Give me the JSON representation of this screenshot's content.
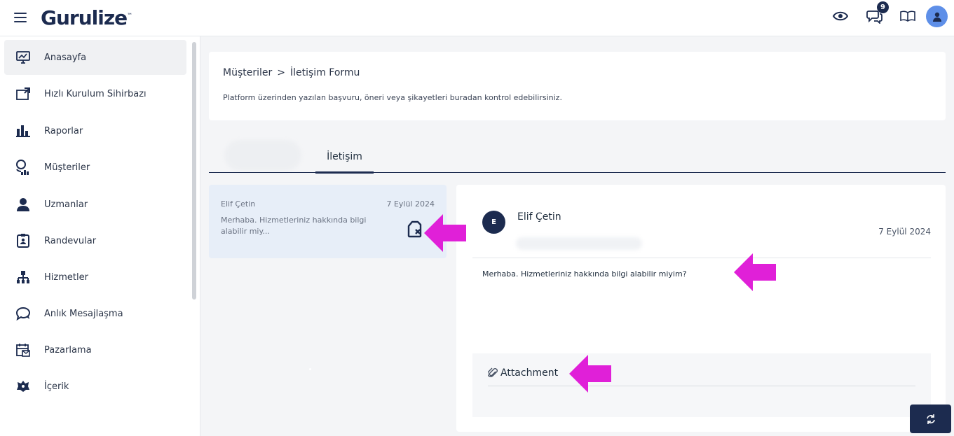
{
  "header": {
    "logo": "Gurulize",
    "logo_mark": "™",
    "notification_count": "9",
    "icons": [
      "eye-icon",
      "chat-bubbles-icon",
      "book-icon",
      "user-avatar-icon"
    ]
  },
  "sidebar": {
    "items": [
      {
        "label": "Anasayfa",
        "icon": "monitor-chart-icon",
        "active": true
      },
      {
        "label": "Hızlı Kurulum Sihirbazı",
        "icon": "setup-wizard-icon"
      },
      {
        "label": "Raporlar",
        "icon": "bar-chart-icon"
      },
      {
        "label": "Müşteriler",
        "icon": "customers-icon"
      },
      {
        "label": "Uzmanlar",
        "icon": "experts-icon"
      },
      {
        "label": "Randevular",
        "icon": "appointments-icon"
      },
      {
        "label": "Hizmetler",
        "icon": "services-icon"
      },
      {
        "label": "Anlık Mesajlaşma",
        "icon": "chat-icon"
      },
      {
        "label": "Pazarlama",
        "icon": "marketing-icon"
      },
      {
        "label": "İçerik",
        "icon": "content-icon"
      }
    ]
  },
  "breadcrumb": {
    "parent": "Müşteriler",
    "separator": ">",
    "current": "İletişim Formu",
    "description": "Platform üzerinden yazılan başvuru, öneri veya şikayetleri buradan kontrol edebilirsiniz."
  },
  "tabs": {
    "active_label": "İletişim"
  },
  "message_list": [
    {
      "name": "Elif Çetin",
      "date": "7 Eylül 2024",
      "preview": "Merhaba. Hizmetleriniz hakkında bilgi alabilir miy..."
    }
  ],
  "detail": {
    "avatar_initial": "E",
    "name": "Elif Çetin",
    "date": "7 Eylül 2024",
    "body": "Merhaba. Hizmetleriniz hakkında bilgi alabilir miyim?",
    "attachment_label": "Attachment"
  },
  "colors": {
    "brand_navy": "#1c2b4f",
    "accent_blue": "#5e8fe8",
    "selected_item_bg": "#e7eef8",
    "annotation_magenta": "#e020d8"
  }
}
